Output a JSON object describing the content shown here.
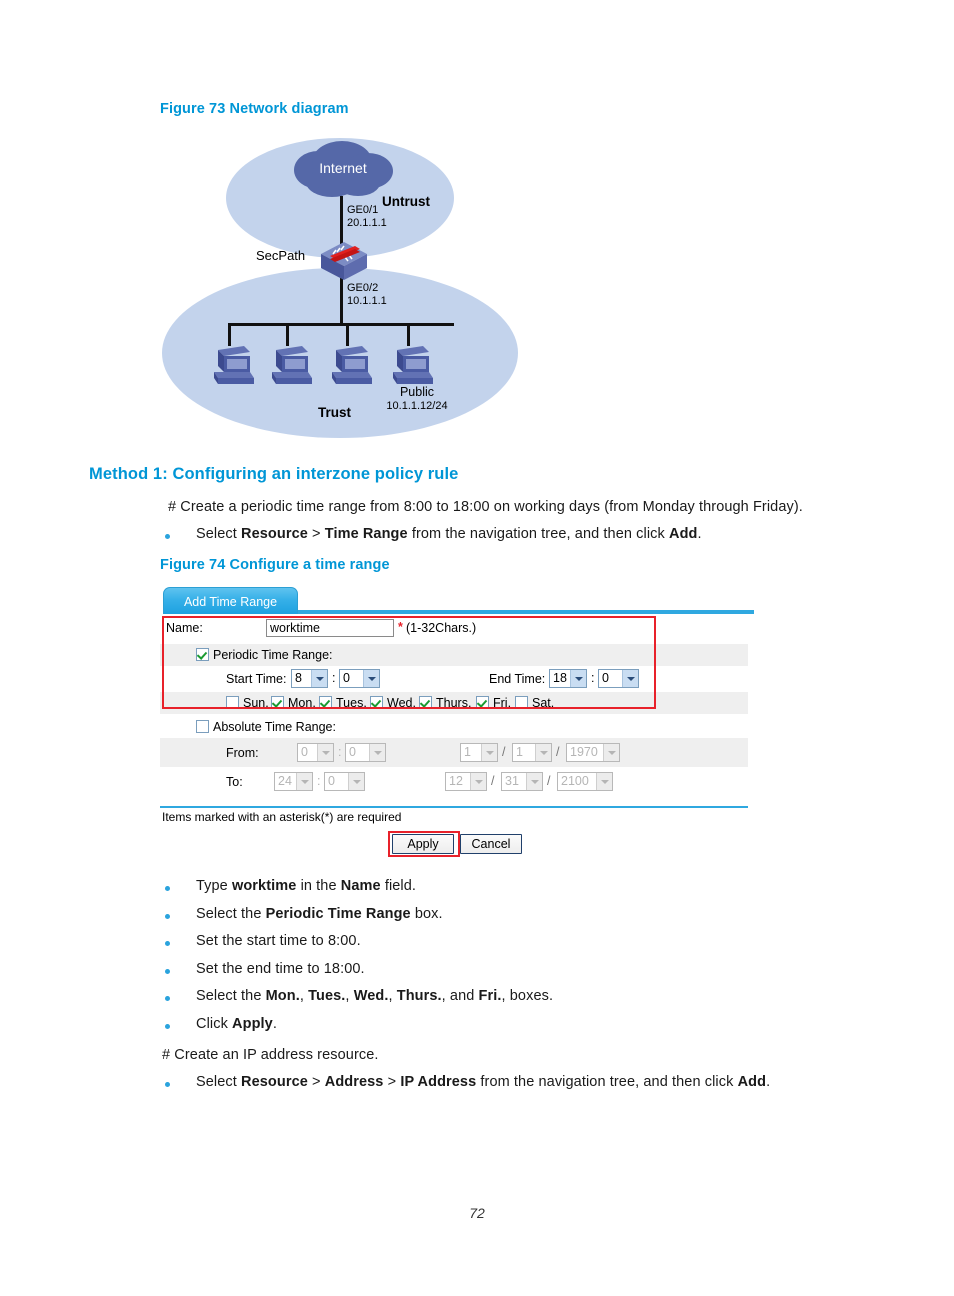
{
  "figure73": {
    "caption": "Figure 73 Network diagram",
    "cloud_label": "Internet",
    "untrust_label": "Untrust",
    "trust_label": "Trust",
    "device_label": "SecPath",
    "iface_top_name": "GE0/1",
    "iface_top_ip": "20.1.1.1",
    "iface_bottom_name": "GE0/2",
    "iface_bottom_ip": "10.1.1.1",
    "host_label": "Public",
    "host_ip": "10.1.1.12/24",
    "colors": {
      "zone_fill": "#c3d3ec",
      "cloud_fill": "#5568a8",
      "device_red": "#e02020",
      "pc_blue": "#4a5ba3"
    }
  },
  "method_section": {
    "heading": "Method 1: Configuring an interzone policy rule",
    "intro_note": "# Create a periodic time range from 8:00 to 18:00 on working days (from Monday through Friday).",
    "intro_bullet": {
      "pre": "Select ",
      "b1": "Resource",
      "sep1": " > ",
      "b2": "Time Range",
      "mid": " from the navigation tree, and then click ",
      "b3": "Add",
      "post": "."
    }
  },
  "figure74": {
    "caption": "Figure 74 Configure a time range",
    "tab_label": "Add Time Range",
    "name_label": "Name:",
    "name_value": "worktime",
    "name_required_mark": "*",
    "name_hint": "(1-32Chars.)",
    "periodic_label": "Periodic Time Range:",
    "periodic_checked": true,
    "start_time_label": "Start Time:",
    "start_hour": "8",
    "start_minute": "0",
    "end_time_label": "End Time:",
    "end_hour": "18",
    "end_minute": "0",
    "days": [
      {
        "label": "Sun.",
        "checked": false
      },
      {
        "label": "Mon.",
        "checked": true
      },
      {
        "label": "Tues.",
        "checked": true
      },
      {
        "label": "Wed.",
        "checked": true
      },
      {
        "label": "Thurs.",
        "checked": true
      },
      {
        "label": "Fri.",
        "checked": true
      },
      {
        "label": "Sat.",
        "checked": false
      }
    ],
    "absolute_label": "Absolute Time Range:",
    "absolute_checked": false,
    "from_label": "From:",
    "from_hour": "0",
    "from_minute": "0",
    "from_month": "1",
    "from_day": "1",
    "from_year": "1970",
    "to_label": "To:",
    "to_hour": "24",
    "to_minute": "0",
    "to_month": "12",
    "to_day": "31",
    "to_year": "2100",
    "required_note": "Items marked with an asterisk(*) are required",
    "apply_label": "Apply",
    "cancel_label": "Cancel"
  },
  "steps": {
    "items": [
      {
        "pre": "Type ",
        "b1": "worktime",
        "mid": " in the ",
        "b2": "Name",
        "post": " field."
      },
      {
        "pre": "Select the ",
        "b1": "Periodic Time Range",
        "mid": "",
        "b2": "",
        "post": " box."
      },
      {
        "pre": "Set the start time to 8:00.",
        "b1": "",
        "mid": "",
        "b2": "",
        "post": ""
      },
      {
        "pre": "Set the end time to 18:00.",
        "b1": "",
        "mid": "",
        "b2": "",
        "post": ""
      },
      {
        "pre": "Select the ",
        "b1": "Mon.",
        "mid": ", ",
        "b2": "Tues.",
        "post": ""
      },
      {
        "pre": "Click ",
        "b1": "Apply",
        "mid": "",
        "b2": "",
        "post": "."
      }
    ],
    "days_line": {
      "pre": "Select the ",
      "b1": "Mon.",
      "s1": ", ",
      "b2": "Tues.",
      "s2": ", ",
      "b3": "Wed.",
      "s3": ", ",
      "b4": "Thurs.",
      "s4": ", and ",
      "b5": "Fri.",
      "post": ", boxes."
    }
  },
  "ip_section": {
    "note": "# Create an IP address resource.",
    "bullet": {
      "pre": "Select ",
      "b1": "Resource",
      "sep1": " > ",
      "b2": "Address",
      "sep2": " > ",
      "b3": "IP Address",
      "mid": " from the navigation tree, and then click ",
      "b4": "Add",
      "post": "."
    }
  },
  "footer": {
    "page_number": "72"
  }
}
